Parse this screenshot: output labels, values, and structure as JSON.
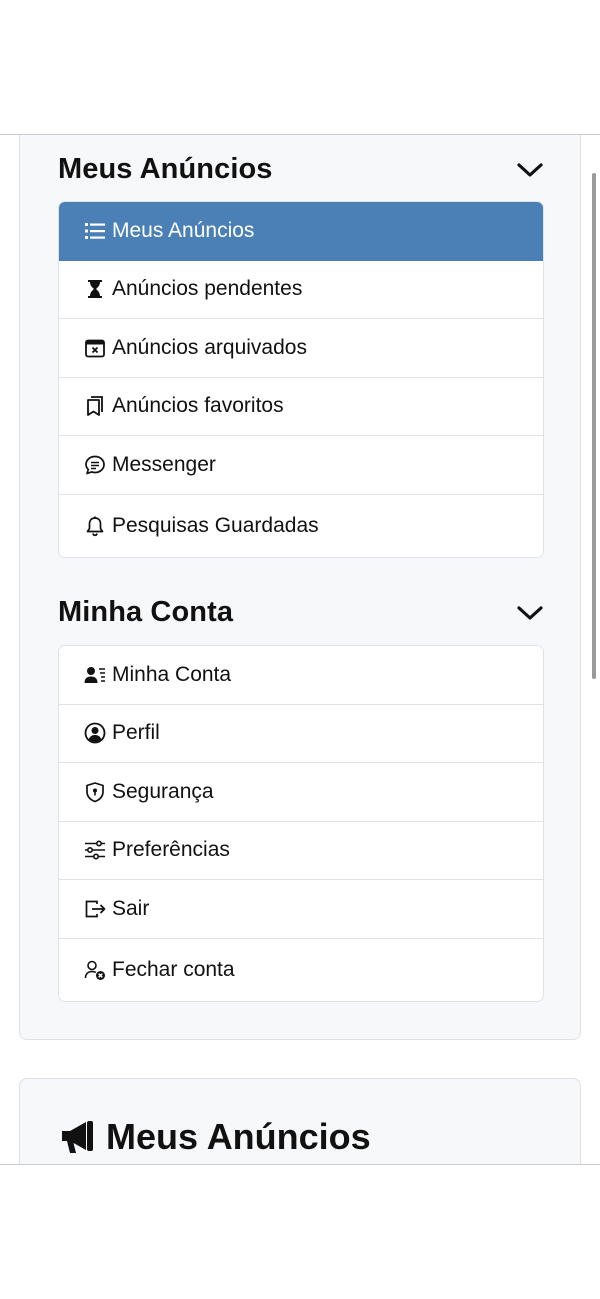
{
  "sections": [
    {
      "title": "Meus Anúncios",
      "items": [
        {
          "label": "Meus Anúncios",
          "icon": "list-icon",
          "active": true
        },
        {
          "label": "Anúncios pendentes",
          "icon": "hourglass-icon"
        },
        {
          "label": "Anúncios arquivados",
          "icon": "calendar-x-icon"
        },
        {
          "label": "Anúncios favoritos",
          "icon": "bookmarks-icon"
        },
        {
          "label": "Messenger",
          "icon": "chat-icon"
        },
        {
          "label": "Pesquisas Guardadas",
          "icon": "bell-icon"
        }
      ]
    },
    {
      "title": "Minha Conta",
      "items": [
        {
          "label": "Minha Conta",
          "icon": "person-lines-icon"
        },
        {
          "label": "Perfil",
          "icon": "person-circle-icon"
        },
        {
          "label": "Segurança",
          "icon": "shield-lock-icon"
        },
        {
          "label": "Preferências",
          "icon": "sliders-icon"
        },
        {
          "label": "Sair",
          "icon": "box-arrow-right-icon"
        },
        {
          "label": "Fechar conta",
          "icon": "person-x-icon"
        }
      ]
    }
  ],
  "content": {
    "title": "Meus Anúncios",
    "icon": "megaphone-icon"
  },
  "colors": {
    "active_bg": "#4a80b6",
    "panel_bg": "#f7f8fa",
    "border": "#dfe3e7"
  }
}
